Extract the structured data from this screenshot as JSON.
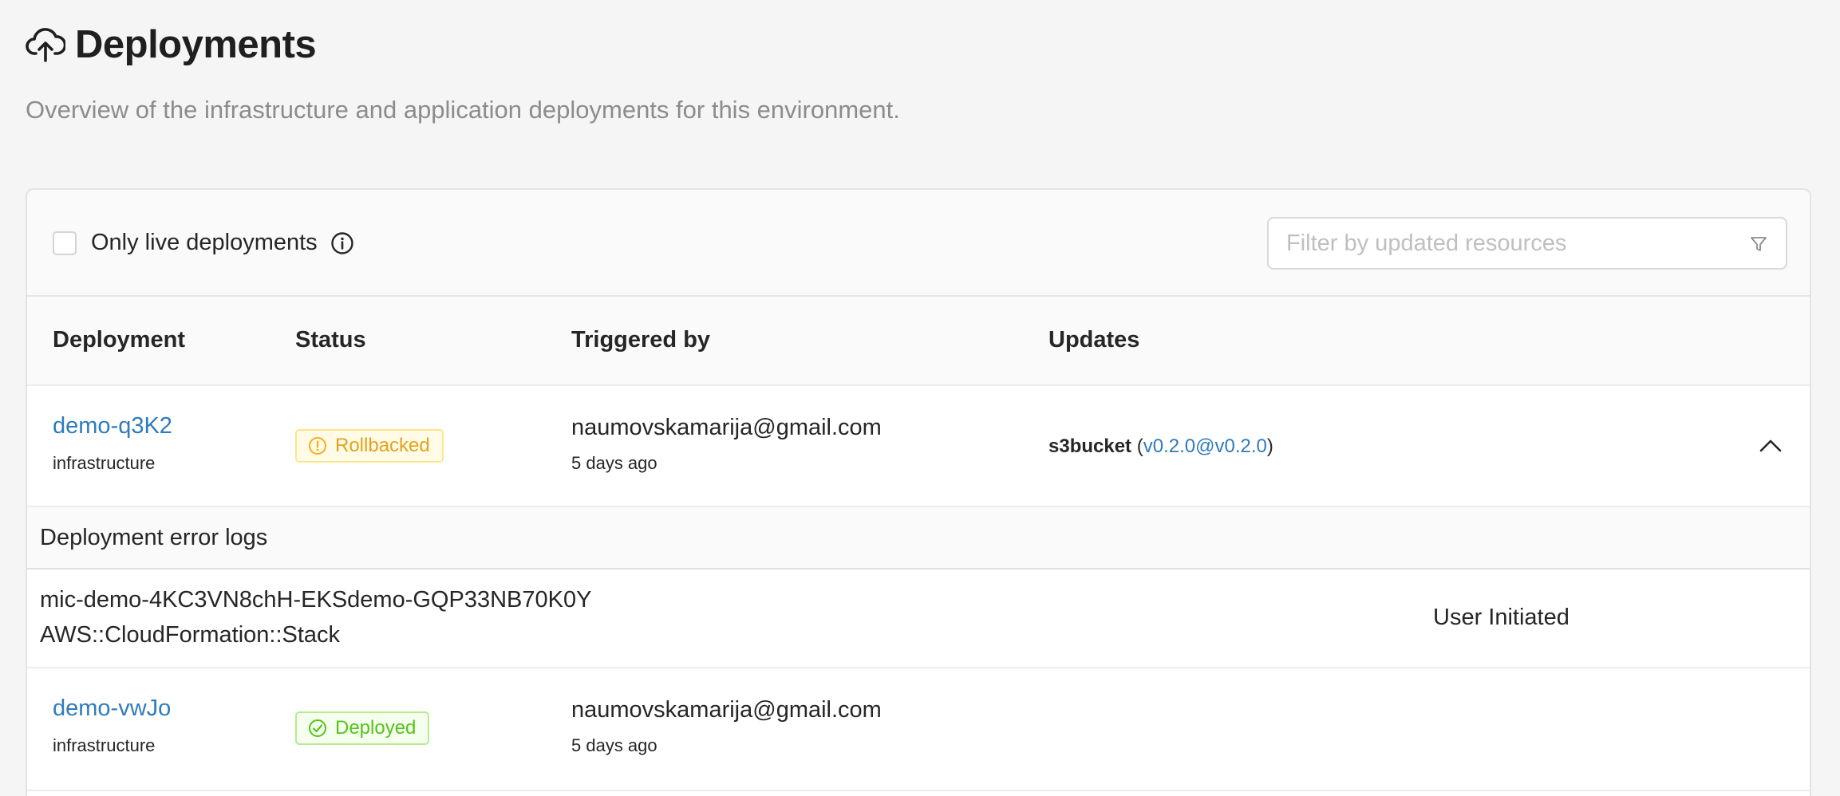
{
  "header": {
    "title": "Deployments",
    "subtitle": "Overview of the infrastructure and application deployments for this environment.",
    "icon": "cloud-upload-icon"
  },
  "toolbar": {
    "live_only_label": "Only live deployments",
    "live_only_checked": false,
    "info_icon": "info-icon",
    "filter_placeholder": "Filter by updated resources",
    "filter_value": "",
    "filter_icon": "funnel-icon"
  },
  "table": {
    "columns": [
      "Deployment",
      "Status",
      "Triggered by",
      "Updates"
    ],
    "rows": [
      {
        "name": "demo-q3K2",
        "type": "infrastructure",
        "status": "Rollbacked",
        "status_icon": "warning-circle-icon",
        "status_color": "#faad14",
        "triggered_by": "naumovskamarija@gmail.com",
        "time": "5 days ago",
        "update_resource": "s3bucket",
        "update_version": "v0.2.0@v0.2.0",
        "expanded": true
      },
      {
        "name": "demo-vwJo",
        "type": "infrastructure",
        "status": "Deployed",
        "status_icon": "check-circle-icon",
        "status_color": "#52c41a",
        "triggered_by": "naumovskamarija@gmail.com",
        "time": "5 days ago",
        "update_resource": "",
        "update_version": "",
        "expanded": false
      }
    ]
  },
  "error_logs": {
    "title": "Deployment error logs",
    "entries": [
      {
        "resource": "mic-demo-4KC3VN8chH-EKSdemo-GQP33NB70K0Y",
        "type": "AWS::CloudFormation::Stack",
        "reason": "User Initiated"
      }
    ]
  },
  "colors": {
    "link": "#2f7bbd",
    "warning": "#faad14",
    "success": "#52c41a",
    "background": "#f5f5f5"
  }
}
